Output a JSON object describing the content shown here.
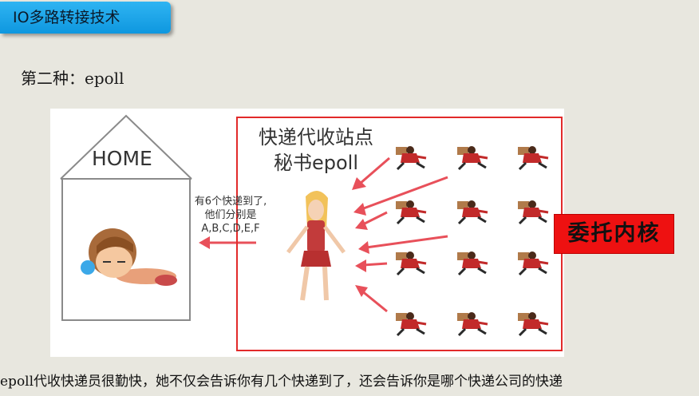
{
  "slide": {
    "title": "IO多路转接技术",
    "heading": "第二种：epoll",
    "caption": "epoll代收快递员很勤快，她不仅会告诉你有几个快递到了，还会告诉你是哪个快递公司的快递"
  },
  "figure": {
    "home_label": "HOME",
    "service_title_line1": "快递代收站点",
    "service_title_line2": "秘书epoll",
    "message_lines": [
      "有6个快递到了,",
      "他们分别是",
      "A,B,C,D,E,F"
    ],
    "kernel_label": "委托内核"
  },
  "colors": {
    "title_tab": "#1ea8ec",
    "box_border": "#e22a2a",
    "arrow": "#e8505a",
    "kernel_bg": "#ee1111"
  }
}
